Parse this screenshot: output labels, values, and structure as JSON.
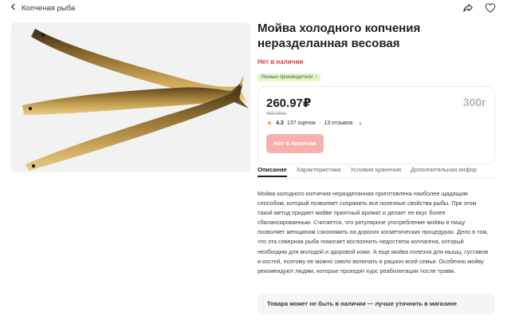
{
  "header": {
    "back_label": "Копченая рыба",
    "share_icon": "share-icon",
    "favorite_icon": "heart-icon"
  },
  "product": {
    "title": "Мойва холодного копчения неразделанная весовая",
    "status": "Нет в наличии",
    "manufacturer_chip": "Разные производители",
    "image_alt": "smoked-capelin-photo"
  },
  "price_card": {
    "price": "260.97₽",
    "old_price": "869.9₽/кг",
    "weight": "300г",
    "rating": "4.3",
    "ratings_count": "137 оценок",
    "reviews_count": "13 отзывов",
    "button_label": "Нет в наличии"
  },
  "tabs": [
    {
      "label": "Описание",
      "active": true
    },
    {
      "label": "Характеристики",
      "active": false
    },
    {
      "label": "Условия хранения",
      "active": false
    },
    {
      "label": "Дополнительная инфор",
      "active": false
    }
  ],
  "description": "Мойва холодного копчения неразделанная приготовлена наиболее щадящим способом, который позволяет сохранить все полезные свойства рыбы. При этом такой метод придает мойве приятный аромат и делает ее вкус более сбалансированным. Считается, что регулярное употребление мойвы в пищу позволяет женщинам сэкономить на дорогих косметических процедурах. Дело в том, что эта северная рыба помогает восполнить недостаток коллагена, который необходим для молодой и здоровой кожи. А еще мойва полезна для мышц, суставов и костей, поэтому ее можно смело включать в рацион всей семьи. Особенно мойву рекомендуют людям, которые проходят курс реабилитации после травм.",
  "notice": "Товара может не быть в наличии — лучше уточнить в магазине",
  "colors": {
    "accent_red": "#d63a3a",
    "button_disabled": "#f6b0b0",
    "chip_bg": "#e3f7cf",
    "star": "#f5a623"
  }
}
